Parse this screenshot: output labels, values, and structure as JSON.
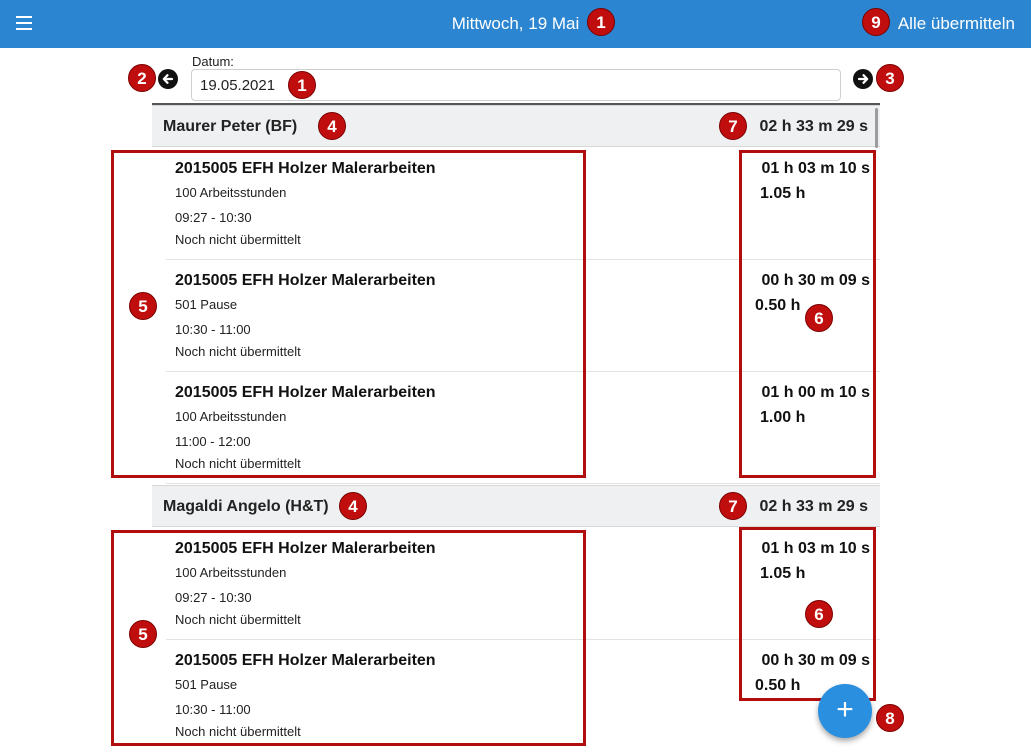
{
  "header": {
    "title": "Mittwoch, 19 Mai",
    "submit_all_label": "Alle übermitteln",
    "menu_icon": "hamburger-menu-icon"
  },
  "date_field": {
    "label": "Datum:",
    "value": "19.05.2021",
    "prev_icon": "arrow-left-circle-icon",
    "next_icon": "arrow-right-circle-icon"
  },
  "groups": [
    {
      "name": "Maurer Peter (BF)",
      "total": "02 h 33 m 29 s",
      "entries": [
        {
          "project": "2015005 EFH Holzer Malerarbeiten",
          "activity": "100 Arbeitsstunden",
          "time_range": "09:27 - 10:30",
          "status": "Noch nicht übermittelt",
          "duration": "01 h 03 m 10 s",
          "decimal": "1.05 h"
        },
        {
          "project": "2015005 EFH Holzer Malerarbeiten",
          "activity": "501 Pause",
          "time_range": "10:30 - 11:00",
          "status": "Noch nicht übermittelt",
          "duration": "00 h 30 m 09 s",
          "decimal": "0.50 h"
        },
        {
          "project": "2015005 EFH Holzer Malerarbeiten",
          "activity": "100 Arbeitsstunden",
          "time_range": "11:00 - 12:00",
          "status": "Noch nicht übermittelt",
          "duration": "01 h 00 m 10 s",
          "decimal": "1.00 h"
        }
      ]
    },
    {
      "name": "Magaldi Angelo (H&T)",
      "total": "02 h 33 m 29 s",
      "entries": [
        {
          "project": "2015005 EFH Holzer Malerarbeiten",
          "activity": "100 Arbeitsstunden",
          "time_range": "09:27 - 10:30",
          "status": "Noch nicht übermittelt",
          "duration": "01 h 03 m 10 s",
          "decimal": "1.05 h"
        },
        {
          "project": "2015005 EFH Holzer Malerarbeiten",
          "activity": "501 Pause",
          "time_range": "10:30 - 11:00",
          "status": "Noch nicht übermittelt",
          "duration": "00 h 30 m 09 s",
          "decimal": "0.50 h"
        }
      ]
    }
  ],
  "fab": {
    "label": "+",
    "icon": "plus-icon"
  },
  "callouts": {
    "c1": "1",
    "c2": "2",
    "c3": "3",
    "c4": "4",
    "c5": "5",
    "c6": "6",
    "c7": "7",
    "c8": "8",
    "c9": "9"
  },
  "colors": {
    "header_bg": "#2b85d0",
    "callout": "#c00e0e",
    "fab": "#2b8fe0"
  }
}
